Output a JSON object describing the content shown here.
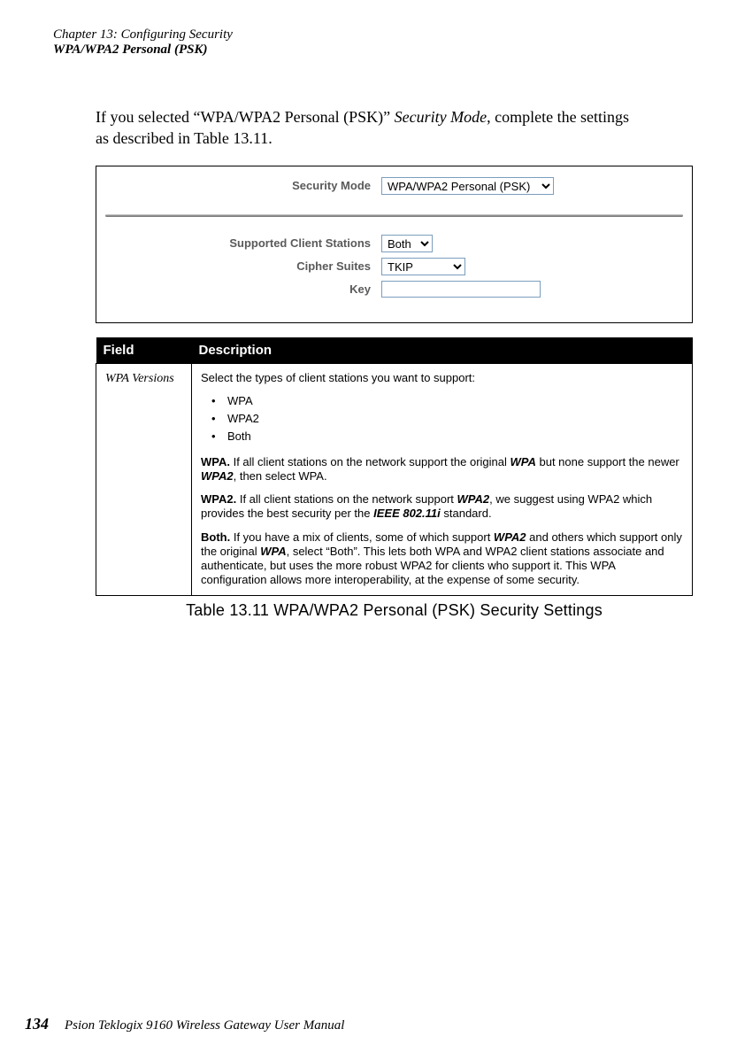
{
  "header": {
    "chapter": "Chapter 13:  Configuring Security",
    "section": "WPA/WPA2 Personal (PSK)"
  },
  "intro": {
    "line1": "If you selected “WPA/WPA2 Personal (PSK)” ",
    "line1_italic": "Security Mode",
    "line1_end": ", complete the settings",
    "line2": "as described in Table 13.11."
  },
  "form": {
    "security_mode_label": "Security Mode",
    "security_mode_value": "WPA/WPA2 Personal (PSK)",
    "supported_label": "Supported Client Stations",
    "supported_value": "Both",
    "cipher_label": "Cipher Suites",
    "cipher_value": "TKIP",
    "key_label": "Key",
    "key_value": ""
  },
  "table": {
    "headers": {
      "field": "Field",
      "description": "Description"
    },
    "row1": {
      "field": "WPA Versions",
      "intro": "Select the types of client stations you want to support:",
      "bullets": [
        "WPA",
        "WPA2",
        "Both"
      ],
      "wpa_label": "WPA.",
      "wpa_text": " If all client stations on the network support the original ",
      "wpa_bi1": "WPA",
      "wpa_text2": " but none support the newer ",
      "wpa_bi2": "WPA2",
      "wpa_text3": ", then select WPA.",
      "wpa2_label": "WPA2.",
      "wpa2_text": " If all client stations on the network support ",
      "wpa2_bi1": "WPA2",
      "wpa2_text2": ", we suggest using WPA2 which provides the best security per the ",
      "wpa2_bi2": "IEEE 802.11i",
      "wpa2_text3": " standard.",
      "both_label": "Both.",
      "both_text": " If you have a mix of clients, some of which support ",
      "both_bi1": "WPA2",
      "both_text2": " and others which support only the original ",
      "both_bi2": "WPA",
      "both_text3": ", select “Both”. This lets both WPA and WPA2 client stations associate and authenticate, but uses the more robust WPA2 for clients who support it. This WPA configuration allows more interoperability, at the expense of some security."
    },
    "caption": "Table 13.11 WPA/WPA2 Personal (PSK) Security Settings"
  },
  "footer": {
    "page": "134",
    "text": "Psion Teklogix 9160 Wireless Gateway User Manual"
  }
}
